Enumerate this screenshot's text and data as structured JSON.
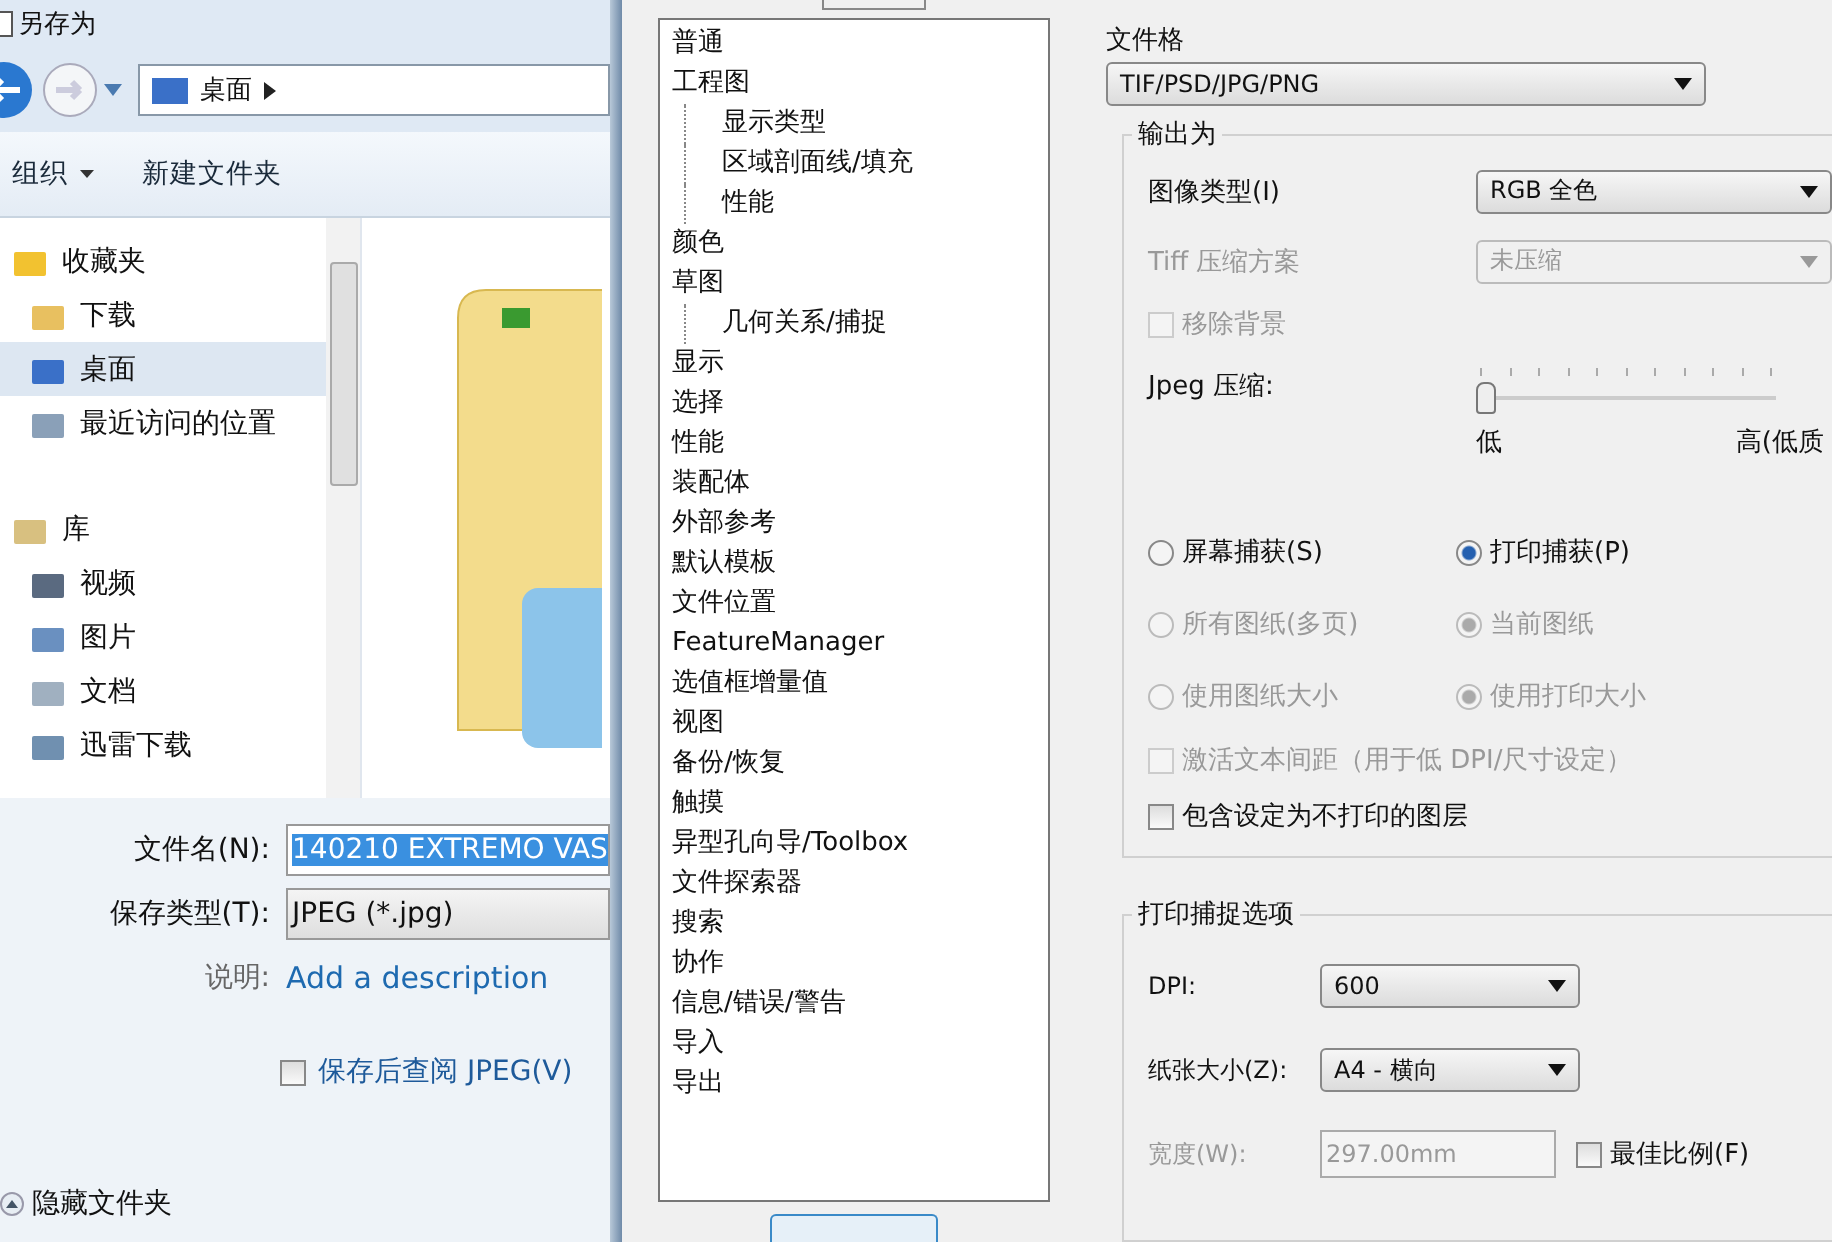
{
  "save_dialog": {
    "title": "另存为",
    "address": "桌面",
    "toolbar": [
      {
        "label": "组织",
        "kind": "menu"
      },
      {
        "label": "新建文件夹",
        "kind": "action"
      }
    ],
    "nav_pane": [
      {
        "label": "收藏夹",
        "kind": "header",
        "selected": false
      },
      {
        "label": "下载",
        "kind": "item",
        "selected": false
      },
      {
        "label": "桌面",
        "kind": "item",
        "selected": true
      },
      {
        "label": "最近访问的位置",
        "kind": "item",
        "selected": false
      },
      {
        "label": "库",
        "kind": "header",
        "selected": false
      },
      {
        "label": "视频",
        "kind": "item",
        "selected": false
      },
      {
        "label": "图片",
        "kind": "item",
        "selected": false
      },
      {
        "label": "文档",
        "kind": "item",
        "selected": false
      },
      {
        "label": "迅雷下载",
        "kind": "item",
        "selected": false
      }
    ],
    "filename_label": "文件名(N):",
    "filename": "140210 EXTREMO VAS",
    "filetype_label": "保存类型(T):",
    "filetype": "JPEG (*.jpg)",
    "description_label": "说明:",
    "description_link": "Add a description",
    "view_after_save": {
      "label": "保存后查阅 JPEG(V)",
      "checked": false
    },
    "hide_folders": "隐藏文件夹"
  },
  "options_tree": [
    {
      "label": "普通"
    },
    {
      "label": "工程图",
      "children": [
        {
          "label": "显示类型"
        },
        {
          "label": "区域剖面线/填充"
        },
        {
          "label": "性能"
        }
      ]
    },
    {
      "label": "颜色"
    },
    {
      "label": "草图",
      "children": [
        {
          "label": "几何关系/捕捉"
        }
      ]
    },
    {
      "label": "显示"
    },
    {
      "label": "选择"
    },
    {
      "label": "性能"
    },
    {
      "label": "装配体"
    },
    {
      "label": "外部参考"
    },
    {
      "label": "默认模板"
    },
    {
      "label": "文件位置"
    },
    {
      "label": "FeatureManager"
    },
    {
      "label": "选值框增量值"
    },
    {
      "label": "视图"
    },
    {
      "label": "备份/恢复"
    },
    {
      "label": "触摸"
    },
    {
      "label": "异型孔向导/Toolbox"
    },
    {
      "label": "文件探索器"
    },
    {
      "label": "搜索"
    },
    {
      "label": "协作"
    },
    {
      "label": "信息/错误/警告"
    },
    {
      "label": "导入"
    },
    {
      "label": "导出"
    }
  ],
  "export": {
    "format_label": "文件格",
    "format": "TIF/PSD/JPG/PNG",
    "output": {
      "title": "输出为",
      "image_type_label": "图像类型(I)",
      "image_type": "RGB 全色",
      "tiff_label": "Tiff 压缩方案",
      "tiff": "未压缩",
      "tiff_disabled": true,
      "remove_background": {
        "label": "移除背景",
        "checked": false,
        "disabled": true
      },
      "jpeg_label": "Jpeg 压缩:",
      "jpeg": {
        "level": 0
      },
      "jpeg_low": "低",
      "jpeg_high": "高(低质",
      "radio_rows": [
        [
          {
            "label": "屏幕捕获(S)",
            "selected": false,
            "disabled": false
          },
          {
            "label": "打印捕获(P)",
            "selected": true,
            "disabled": false
          }
        ],
        [
          {
            "label": "所有图纸(多页)",
            "selected": false,
            "disabled": true
          },
          {
            "label": "当前图纸",
            "selected": true,
            "disabled": true
          }
        ],
        [
          {
            "label": "使用图纸大小",
            "selected": false,
            "disabled": true
          },
          {
            "label": "使用打印大小",
            "selected": true,
            "disabled": true
          }
        ]
      ],
      "checkboxes": [
        {
          "label": "激活文本间距（用于低 DPI/尺寸设定）",
          "checked": false,
          "disabled": true
        },
        {
          "label": "包含设定为不打印的图层",
          "checked": false,
          "disabled": false
        }
      ]
    },
    "print": {
      "title": "打印捕捉选项",
      "dpi_label": "DPI:",
      "dpi": "600",
      "paper_label": "纸张大小(Z):",
      "paper": "A4 - 横向",
      "width_label": "宽度(W):",
      "width": "297.00mm",
      "width_disabled": true,
      "best_scale": {
        "label": "最佳比例(F)",
        "checked": false
      }
    }
  }
}
